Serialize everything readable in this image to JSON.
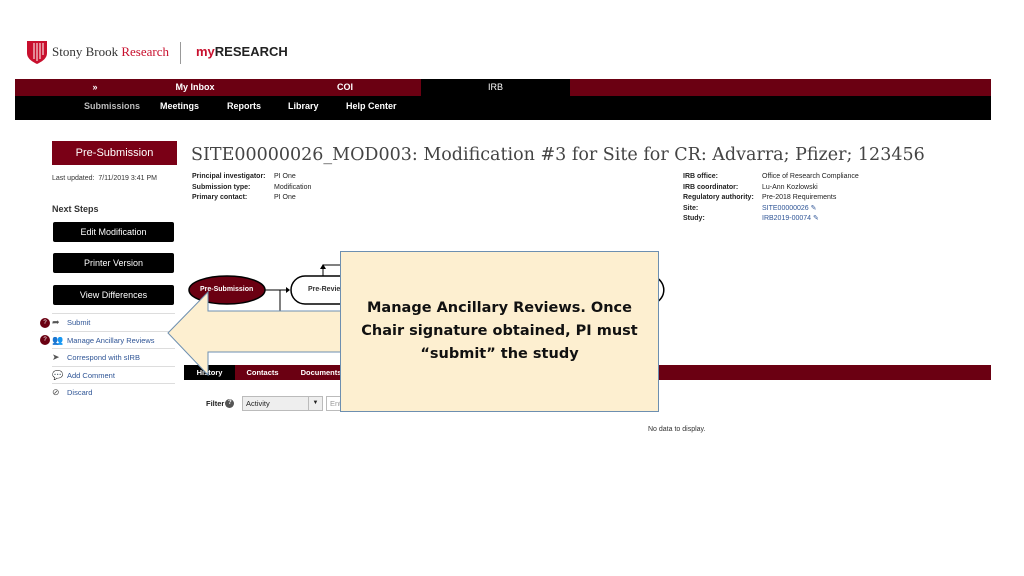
{
  "logo": {
    "org_part1": "Stony Brook ",
    "org_part2": "Research",
    "product_prefix": "my",
    "product": "RESEARCH"
  },
  "topnav": {
    "expand": "»",
    "items": [
      "My Inbox",
      "COI",
      "IRB"
    ]
  },
  "subnav": {
    "items": [
      "Submissions",
      "Meetings",
      "Reports",
      "Library",
      "Help Center"
    ]
  },
  "sidebar": {
    "state": "Pre-Submission",
    "last_updated_label": "Last updated:",
    "last_updated": "7/11/2019 3:41 PM",
    "next_steps": "Next Steps",
    "buttons": [
      "Edit Modification",
      "Printer Version",
      "View Differences"
    ],
    "actions": [
      {
        "label": "Submit",
        "icon": "share-arrow-icon",
        "badge": "?"
      },
      {
        "label": "Manage Ancillary Reviews",
        "icon": "users-icon",
        "badge": "?"
      },
      {
        "label": "Correspond with sIRB",
        "icon": "paper-plane-icon"
      },
      {
        "label": "Add Comment",
        "icon": "comment-icon"
      },
      {
        "label": "Discard",
        "icon": "ban-icon"
      }
    ]
  },
  "header": {
    "title": "SITE00000026_MOD003: Modification #3 for Site for CR: Advarra; Pfizer; 123456"
  },
  "details_left": [
    {
      "label": "Principal investigator:",
      "value": "PI One"
    },
    {
      "label": "Submission type:",
      "value": "Modification"
    },
    {
      "label": "Primary contact:",
      "value": "PI One"
    }
  ],
  "details_right": [
    {
      "label": "IRB office:",
      "value": "Office of Research Compliance"
    },
    {
      "label": "IRB coordinator:",
      "value": "Lu-Ann Kozlowski"
    },
    {
      "label": "Regulatory authority:",
      "value": "Pre-2018 Requirements"
    },
    {
      "label": "Site:",
      "value": "SITE00000026"
    },
    {
      "label": "Study:",
      "value": "IRB2019-00074"
    }
  ],
  "workflow": {
    "states": [
      "Pre-Submission",
      "Pre-Revie"
    ]
  },
  "tabs": [
    "History",
    "Contacts",
    "Documents"
  ],
  "filter": {
    "label": "Filter",
    "selected": "Activity",
    "input_placeholder": "Ent"
  },
  "empty_message": "No data to display.",
  "callout": {
    "text": "Manage Ancillary Reviews. Once Chair signature obtained, PI must “submit” the study"
  },
  "colors": {
    "brand": "#6b0012",
    "callout_fill": "#fdefd0",
    "callout_border": "#6d8fb0"
  }
}
